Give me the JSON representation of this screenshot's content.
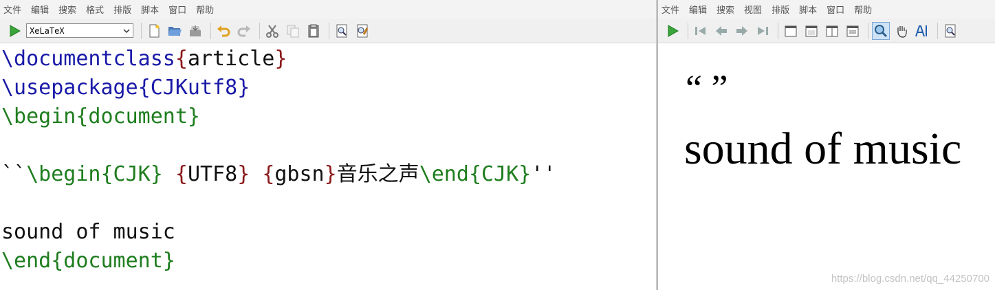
{
  "editor": {
    "menu": [
      "文件",
      "编辑",
      "搜索",
      "格式",
      "排版",
      "脚本",
      "窗口",
      "帮助"
    ],
    "engine": "XeLaTeX",
    "lines": [
      [
        {
          "t": "\\documentclass",
          "c": "cmd"
        },
        {
          "t": "{",
          "c": "brace"
        },
        {
          "t": "article",
          "c": "txt"
        },
        {
          "t": "}",
          "c": "brace"
        }
      ],
      [
        {
          "t": "\\usepackage",
          "c": "cmd"
        },
        {
          "t": "{",
          "c": "cmd"
        },
        {
          "t": "CJKutf8",
          "c": "cmd"
        },
        {
          "t": "}",
          "c": "cmd"
        }
      ],
      [
        {
          "t": "\\begin",
          "c": "env"
        },
        {
          "t": "{document}",
          "c": "env"
        }
      ],
      [],
      [
        {
          "t": "``",
          "c": "txt"
        },
        {
          "t": "\\begin",
          "c": "env"
        },
        {
          "t": "{CJK}",
          "c": "env"
        },
        {
          "t": " ",
          "c": "txt"
        },
        {
          "t": "{",
          "c": "brace"
        },
        {
          "t": "UTF8",
          "c": "txt"
        },
        {
          "t": "}",
          "c": "brace"
        },
        {
          "t": " ",
          "c": "txt"
        },
        {
          "t": "{",
          "c": "brace"
        },
        {
          "t": "gbsn",
          "c": "txt"
        },
        {
          "t": "}",
          "c": "brace"
        },
        {
          "t": "音乐之声",
          "c": "txt"
        },
        {
          "t": "\\end",
          "c": "env"
        },
        {
          "t": "{CJK}",
          "c": "env"
        },
        {
          "t": "''",
          "c": "txt"
        }
      ],
      [],
      [
        {
          "t": "sound of music",
          "c": "txt"
        }
      ],
      [
        {
          "t": "\\end",
          "c": "env"
        },
        {
          "t": "{document}",
          "c": "env"
        }
      ]
    ]
  },
  "viewer": {
    "menu": [
      "文件",
      "编辑",
      "搜索",
      "视图",
      "排版",
      "脚本",
      "窗口",
      "帮助"
    ],
    "quotes": "“      ”",
    "text": "sound of music",
    "watermark": "https://blog.csdn.net/qq_44250700"
  },
  "icons": {
    "editor_toolbar": [
      "run-icon",
      "new-file-icon",
      "open-folder-icon",
      "save-icon",
      "undo-icon",
      "redo-icon",
      "cut-icon",
      "copy-icon",
      "paste-icon",
      "find-icon",
      "replace-icon"
    ],
    "viewer_toolbar": [
      "run-icon",
      "first-page-icon",
      "previous-page-icon",
      "next-page-icon",
      "last-page-icon",
      "single-page-icon",
      "continuous-page-icon",
      "facing-pages-icon",
      "fit-page-icon",
      "magnify-icon",
      "hand-icon",
      "text-select-icon",
      "find-icon"
    ]
  },
  "colors": {
    "command": "#1a1aa8",
    "environment": "#1e7d1e",
    "brace": "#8b1a1a",
    "text": "#111111"
  }
}
